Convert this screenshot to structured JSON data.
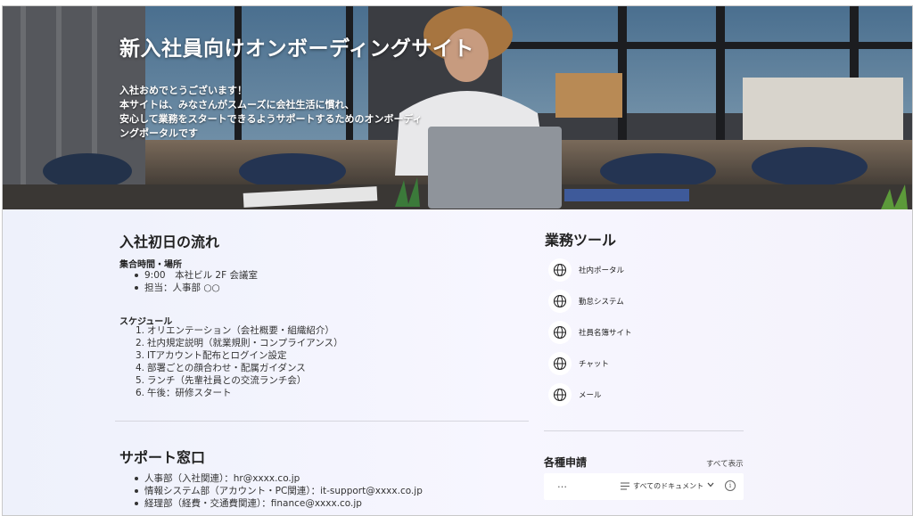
{
  "hero": {
    "title": "新入社員向けオンボーディングサイト",
    "description": [
      "入社おめでとうございます！",
      "本サイトは、みなさんがスムーズに会社生活に慣れ、",
      "安心して業務をスタートできるようサポートするためのオンボーディ",
      "ングポータルです"
    ]
  },
  "first_day": {
    "title": "入社初日の流れ",
    "meeting_label": "集合時間・場所",
    "meeting_items": [
      "9:00　本社ビル 2F 会議室",
      "担当：人事部 ○○"
    ],
    "schedule_label": "スケジュール",
    "schedule_items": [
      {
        "num": "1.",
        "text": "オリエンテーション（会社概要・組織紹介）"
      },
      {
        "num": "2.",
        "text": "社内規定説明（就業規則・コンプライアンス）"
      },
      {
        "num": "3.",
        "text": "ITアカウント配布とログイン設定"
      },
      {
        "num": "4.",
        "text": "部署ごとの顔合わせ・配属ガイダンス"
      },
      {
        "num": "5.",
        "text": "ランチ（先輩社員との交流ランチ会）"
      },
      {
        "num": "6.",
        "text": "午後：研修スタート"
      }
    ]
  },
  "support": {
    "title": "サポート窓口",
    "contacts": [
      {
        "label": "人事部（入社関連）：",
        "email": "hr@xxxx.co.jp"
      },
      {
        "label": "情報システム部（アカウント・PC関連）：",
        "email": "it-support@xxxx.co.jp"
      },
      {
        "label": "経理部（経費・交通費関連）：",
        "email": "finance@xxxx.co.jp"
      }
    ]
  },
  "tools": {
    "title": "業務ツール",
    "icon": "globe-icon",
    "items": [
      "社内ポータル",
      "勤怠システム",
      "社員名簿サイト",
      "チャット",
      "メール"
    ]
  },
  "forms": {
    "title": "各種申請",
    "show_all": "すべて表示",
    "more": "…",
    "filter": "すべてのドキュメント"
  },
  "colors": {
    "page_bg": "#f3f2fb",
    "tool_icon_bg": "#ffffff",
    "divider": "#d6d6de"
  }
}
